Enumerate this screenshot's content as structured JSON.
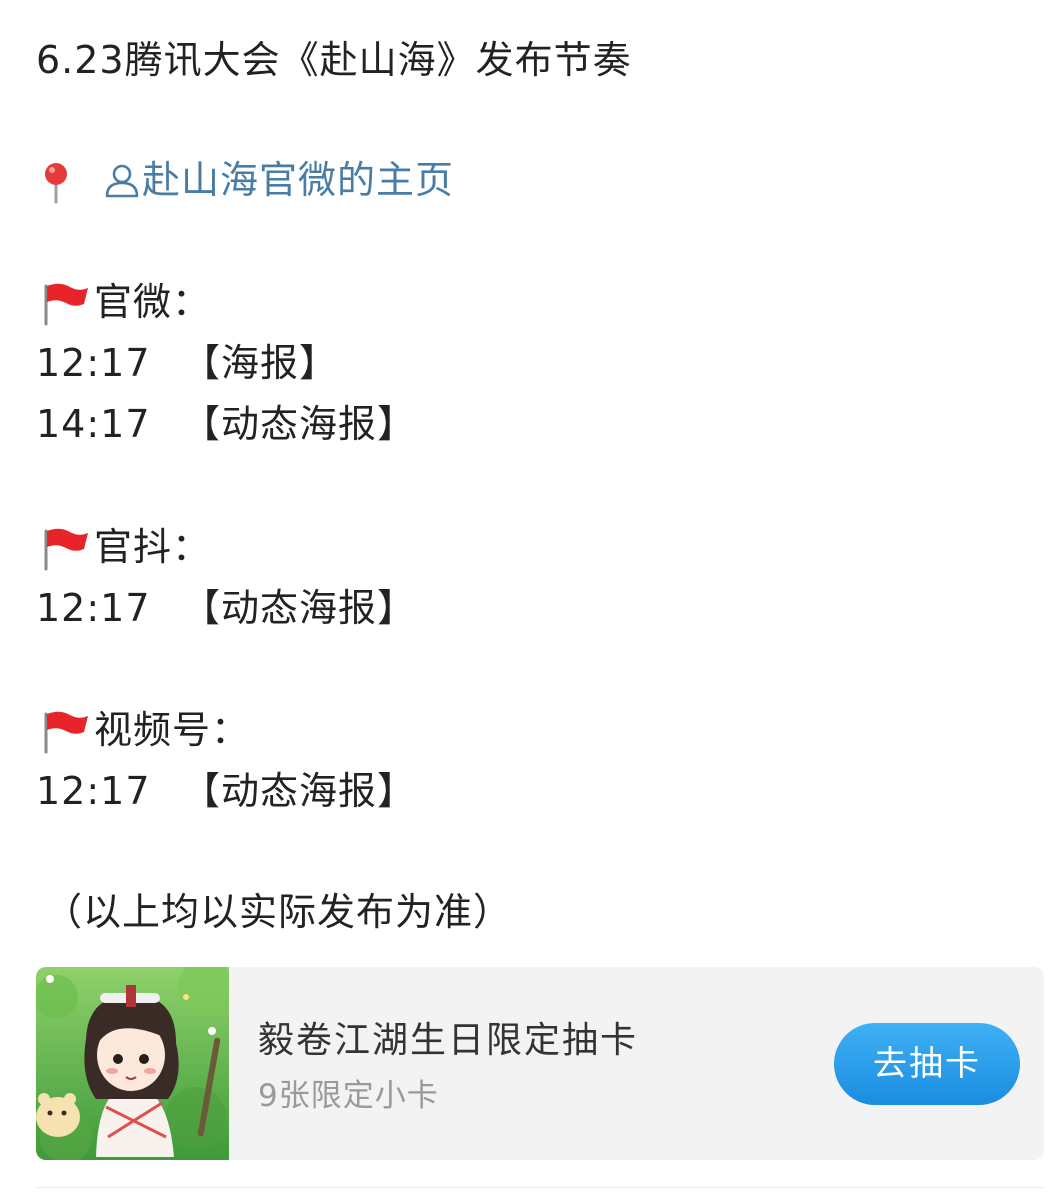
{
  "post": {
    "title": "6.23腾讯大会《赴山海》发布节奏",
    "link_text": "赴山海官微的主页",
    "sections": [
      {
        "label": "官微：",
        "rows": [
          {
            "time": "12:17",
            "item": "【海报】"
          },
          {
            "time": "14:17",
            "item": "【动态海报】"
          }
        ]
      },
      {
        "label": "官抖：",
        "rows": [
          {
            "time": "12:17",
            "item": "【动态海报】"
          }
        ]
      },
      {
        "label": "视频号：",
        "rows": [
          {
            "time": "12:17",
            "item": "【动态海报】"
          }
        ]
      }
    ],
    "note": "（以上均以实际发布为准）"
  },
  "card": {
    "title": "毅卷江湖生日限定抽卡",
    "subtitle": "9张限定小卡",
    "button_label": "去抽卡"
  },
  "colors": {
    "link": "#4a7da6",
    "button": "#1a8de0",
    "flag": "#e8242b"
  },
  "icons": [
    "pin-icon",
    "user-icon",
    "red-flag-icon"
  ]
}
